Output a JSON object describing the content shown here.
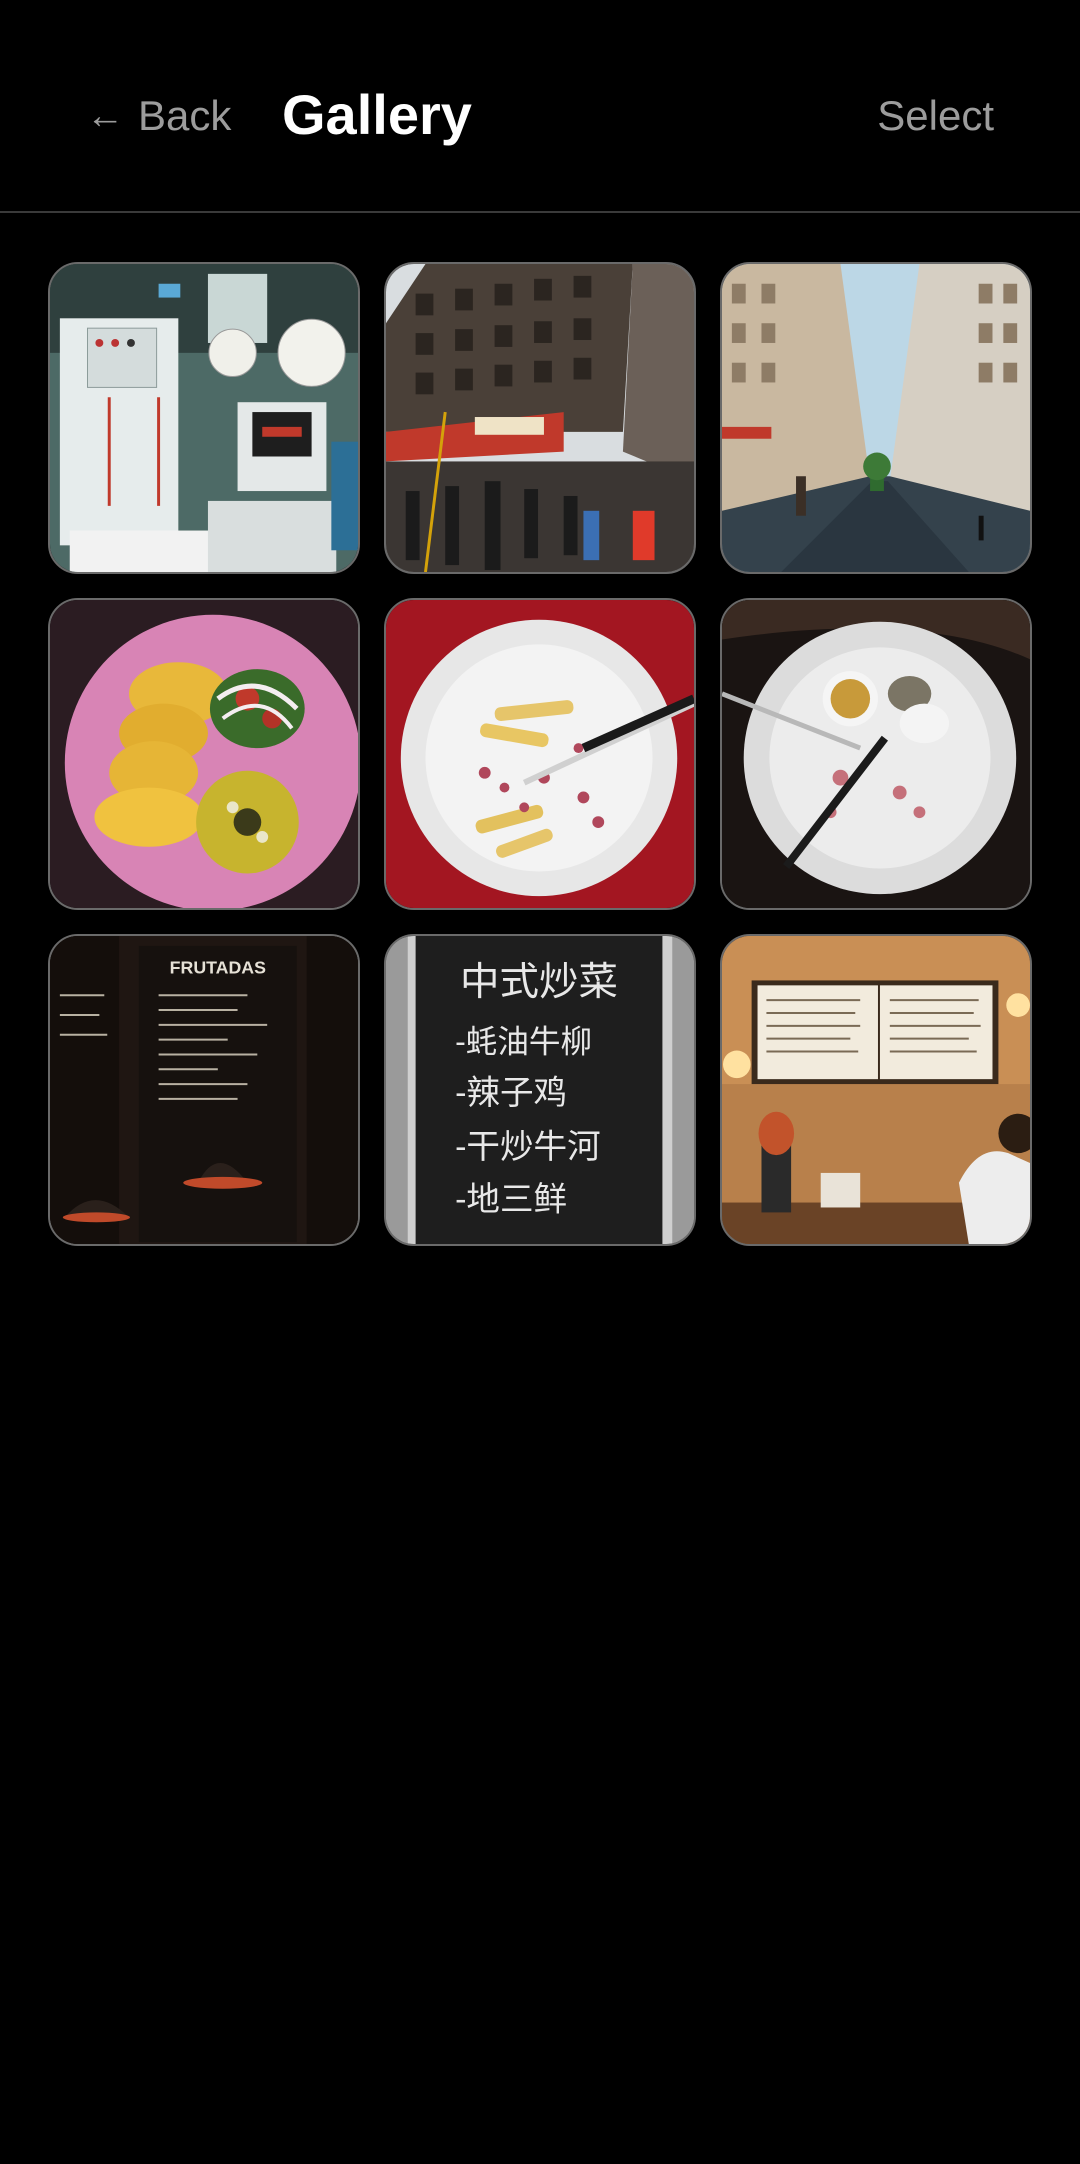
{
  "header": {
    "back_label": "Back",
    "back_icon": "left-arrow-icon",
    "title": "Gallery",
    "select_label": "Select"
  },
  "gallery": {
    "tiles": [
      {
        "name": "photo-machine-packaging",
        "subject": "machine"
      },
      {
        "name": "photo-city-crossroads",
        "subject": "building"
      },
      {
        "name": "photo-street-view",
        "subject": "street"
      },
      {
        "name": "photo-pink-plate",
        "subject": "plate-pink"
      },
      {
        "name": "photo-fries-plate",
        "subject": "plate-red"
      },
      {
        "name": "photo-finished-plate",
        "subject": "plate-dark"
      },
      {
        "name": "photo-chalkboard-menu-bar",
        "subject": "menu-bar"
      },
      {
        "name": "photo-chalkboard-chinese",
        "subject": "chalkboard"
      },
      {
        "name": "photo-coffee-counter",
        "subject": "cafe"
      }
    ],
    "frutadas_text": "FRUTADAS",
    "chalk_lines": [
      "中式炒菜",
      "-蚝油牛柳",
      "-辣子鸡",
      "-干炒牛河",
      "-地三鲜"
    ]
  },
  "colors": {
    "background": "#000000",
    "title": "#ffffff",
    "secondary_text": "#9c9c9c",
    "tile_border": "#6a6a6a"
  }
}
